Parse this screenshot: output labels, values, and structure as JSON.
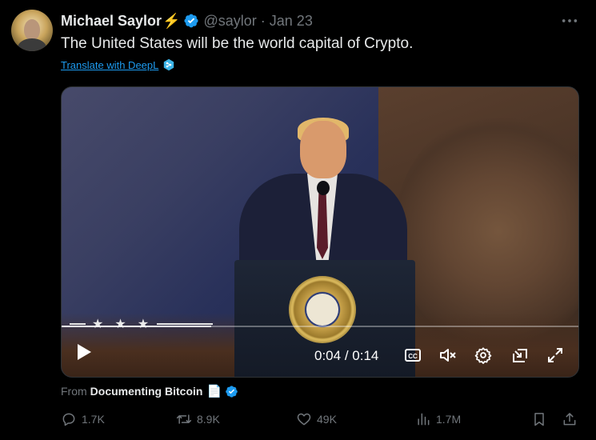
{
  "author": {
    "name": "Michael Saylor",
    "emoji": "⚡",
    "handle": "@saylor",
    "separator": "·",
    "date": "Jan 23"
  },
  "tweet": {
    "text": "The United States will be the world capital of Crypto.",
    "translate_label": "Translate with DeepL"
  },
  "video": {
    "current_time": "0:04",
    "time_sep": " / ",
    "duration": "0:14",
    "progress": 0.29,
    "controls": [
      "play-icon",
      "captions-icon",
      "mute-icon",
      "settings-icon",
      "picture-in-picture-icon",
      "fullscreen-icon"
    ]
  },
  "source": {
    "prefix": "From",
    "name": "Documenting Bitcoin",
    "emoji": "📄"
  },
  "actions": {
    "replies": "1.7K",
    "reposts": "8.9K",
    "likes": "49K",
    "views": "1.7M"
  },
  "colors": {
    "accent": "#1d9bf0",
    "muted": "#71767b",
    "text": "#e7e9ea",
    "background": "#000000",
    "bolt": "#f4b400"
  }
}
